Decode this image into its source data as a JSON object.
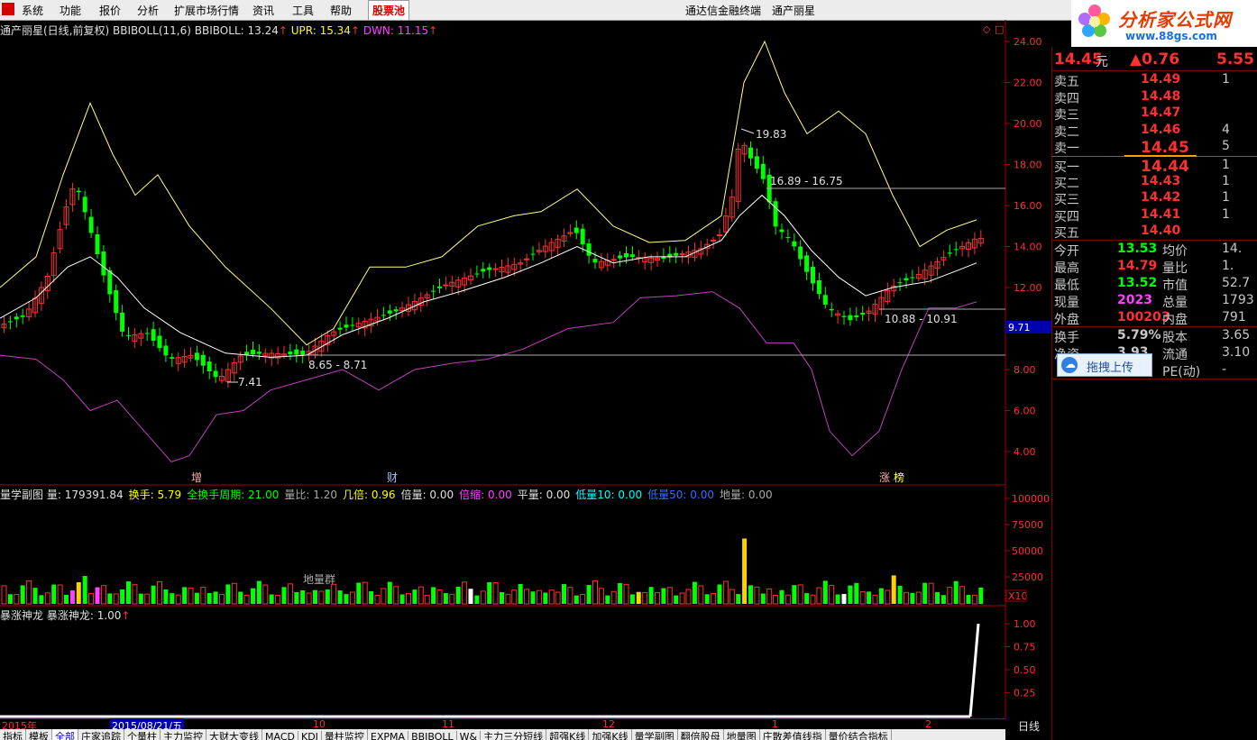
{
  "menu": {
    "items": [
      "系统",
      "功能",
      "报价",
      "分析",
      "扩展市场行情",
      "资讯",
      "工具",
      "帮助"
    ],
    "active_item": "股票池",
    "app_title": "通达信金融终端",
    "stock_title": "通产丽星"
  },
  "brand": {
    "name": "分析家公式网",
    "url": "www.88gs.com"
  },
  "main_chart": {
    "title": "通产丽星(日线,前复权)",
    "ind_name": "BBIBOLL(11,6)",
    "bbiboll": "BBIBOLL: 13.24",
    "upr": "UPR: 15.34",
    "dwn": "DWN: 11.15",
    "y_ticks": [
      "24.00",
      "22.00",
      "20.00",
      "18.00",
      "16.00",
      "14.00",
      "12.00",
      "10.00",
      "8.00",
      "6.00",
      "4.00"
    ],
    "current_price_tag": "9.71",
    "ann_high": "19.83",
    "ann_range1": "16.89 - 16.75",
    "ann_range2": "10.88 - 10.91",
    "ann_range3": "8.65 - 8.71",
    "ann_low": "7.41",
    "marks": [
      "增",
      "财",
      "涨",
      "榜"
    ]
  },
  "vol_chart": {
    "title": "量学副图",
    "items": [
      {
        "text": "量: 179391.84",
        "color": "#e0e0e0"
      },
      {
        "text": "换手: 5.79",
        "color": "#ffff00"
      },
      {
        "text": "全换手周期: 21.00",
        "color": "#00ff00"
      },
      {
        "text": "量比: 1.20",
        "color": "#aaaaaa"
      },
      {
        "text": "几倍: 0.96",
        "color": "#ffff00"
      },
      {
        "text": "倍量: 0.00",
        "color": "#e0e0e0"
      },
      {
        "text": "倍缩: 0.00",
        "color": "#ff40ff"
      },
      {
        "text": "平量: 0.00",
        "color": "#e0e0e0"
      },
      {
        "text": "低量10: 0.00",
        "color": "#00ffff"
      },
      {
        "text": "低量50: 0.00",
        "color": "#3a6cff"
      },
      {
        "text": "地量: 0.00",
        "color": "#aaaaaa"
      }
    ],
    "y_ticks": [
      "100000",
      "75000",
      "50000",
      "25000"
    ],
    "unit": "X10",
    "label": "地量群"
  },
  "ind3": {
    "title": "暴涨神龙",
    "value": "暴涨神龙: 1.00",
    "y_ticks": [
      "1.00",
      "0.75",
      "0.50",
      "0.25"
    ]
  },
  "timeline": {
    "year": "2015年",
    "date": "2015/08/21/五",
    "months": [
      "10",
      "11",
      "12",
      "1",
      "2"
    ],
    "period": "日线"
  },
  "tabs": [
    "指标",
    "模板",
    "全部",
    "庄家追踪",
    "个量柱",
    "主力监控",
    "大财大变线",
    "MACD",
    "KDJ",
    "量柱监控",
    "EXPMA",
    "BBIBOLL",
    "W&",
    "主力三分短线",
    "超强K线",
    "加强K线",
    "量学副图",
    "翻倍股母",
    "地量图",
    "庄散差值线指",
    "量价结合指标"
  ],
  "selected_tab": "全部",
  "quote": {
    "price": "14.45",
    "price_unit": "元",
    "change": "▲0.76",
    "pct": "5.55",
    "asks": [
      {
        "label": "卖五",
        "price": "14.49",
        "vol": "1"
      },
      {
        "label": "卖四",
        "price": "14.48",
        "vol": ""
      },
      {
        "label": "卖三",
        "price": "14.47",
        "vol": ""
      },
      {
        "label": "卖二",
        "price": "14.46",
        "vol": "4"
      },
      {
        "label": "卖一",
        "price": "14.45",
        "vol": "5"
      }
    ],
    "bids": [
      {
        "label": "买一",
        "price": "14.44",
        "vol": "1"
      },
      {
        "label": "买二",
        "price": "14.43",
        "vol": "1"
      },
      {
        "label": "买三",
        "price": "14.42",
        "vol": "1"
      },
      {
        "label": "买四",
        "price": "14.41",
        "vol": "1"
      },
      {
        "label": "买五",
        "price": "14.40",
        "vol": ""
      }
    ],
    "stats": [
      {
        "l1": "今开",
        "v1": "13.53",
        "c1": "#00ff00",
        "l2": "均价",
        "v2": "14."
      },
      {
        "l1": "最高",
        "v1": "14.79",
        "c1": "#ff3030",
        "l2": "量比",
        "v2": "1."
      },
      {
        "l1": "最低",
        "v1": "13.52",
        "c1": "#00ff00",
        "l2": "市值",
        "v2": "52.7"
      },
      {
        "l1": "现量",
        "v1": "2023",
        "c1": "#ff40ff",
        "l2": "总量",
        "v2": "1793"
      },
      {
        "l1": "外盘",
        "v1": "100203",
        "c1": "#ff3030",
        "l2": "内盘",
        "v2": "791"
      }
    ],
    "stats2": [
      {
        "l1": "换手",
        "v1": "5.79%",
        "l2": "股本",
        "v2": "3.65"
      },
      {
        "l1": "净资",
        "v1": "3.93",
        "l2": "流通",
        "v2": "3.10"
      },
      {
        "l1": "",
        "v1": "7",
        "l2": "PE(动)",
        "v2": "-"
      }
    ],
    "upload_label": "拖拽上传"
  }
}
